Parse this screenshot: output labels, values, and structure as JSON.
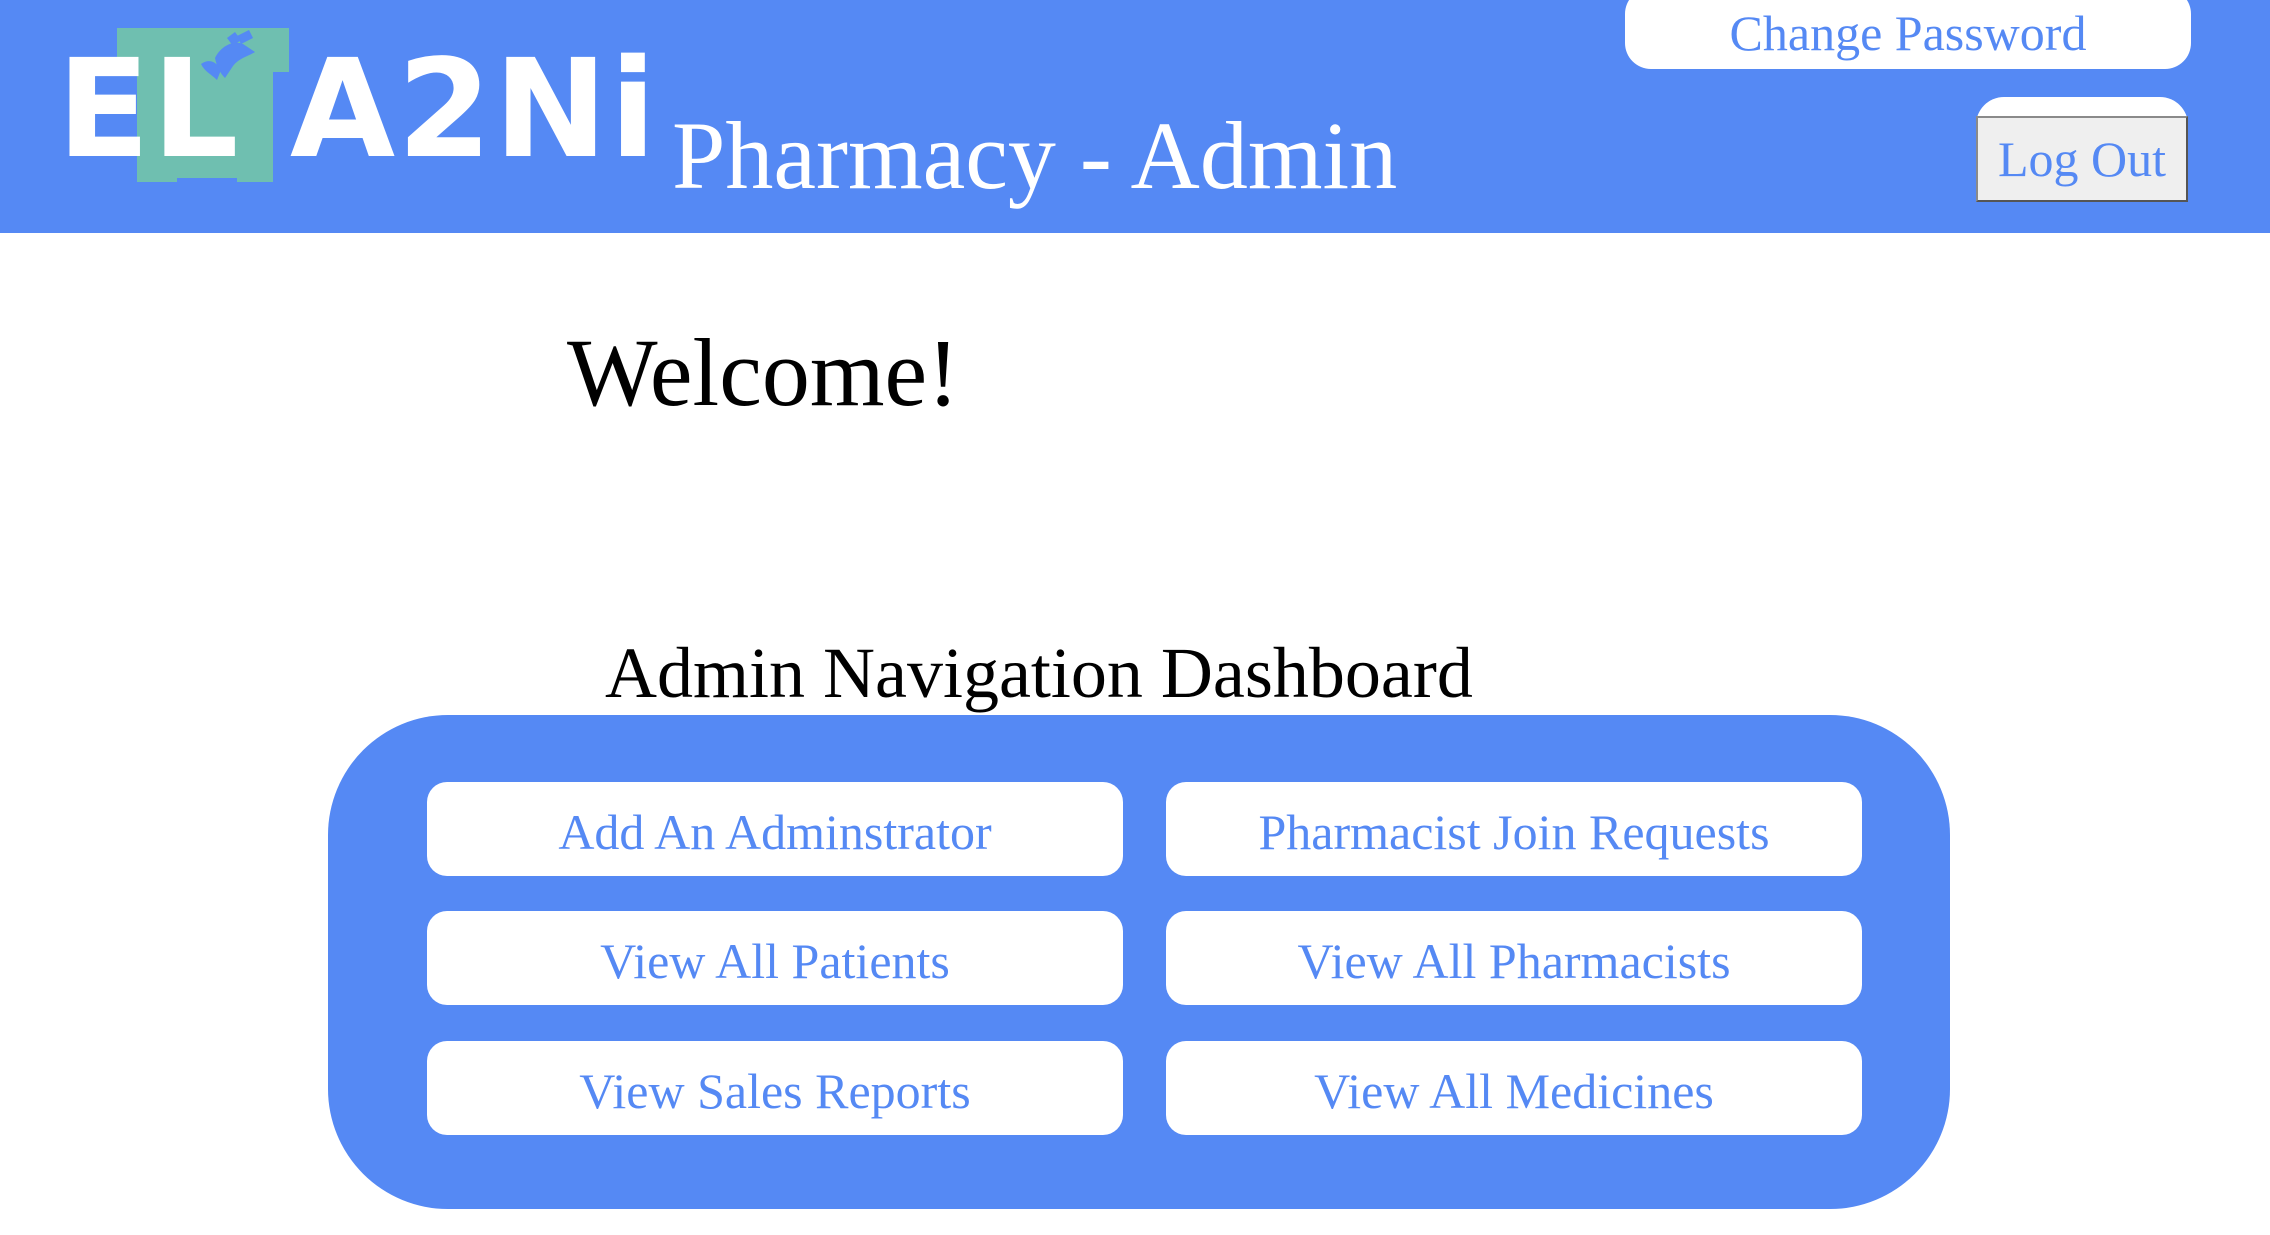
{
  "header": {
    "logo_text": "EL A2Ni",
    "logo_icon": "medical-cross-hands-icon",
    "app_title": "Pharmacy - Admin",
    "change_password_label": "Change Password",
    "logout_label": "Log Out"
  },
  "main": {
    "welcome_text": "Welcome!",
    "dashboard_title": "Admin Navigation Dashboard",
    "nav_buttons": [
      {
        "label": "Add An Adminstrator"
      },
      {
        "label": "Pharmacist Join Requests"
      },
      {
        "label": "View All Patients"
      },
      {
        "label": "View All Pharmacists"
      },
      {
        "label": "View Sales Reports"
      },
      {
        "label": "View All Medicines"
      }
    ]
  },
  "colors": {
    "brand_blue": "#5589f4",
    "logo_teal": "#6fbfb0",
    "background": "#ffffff"
  }
}
